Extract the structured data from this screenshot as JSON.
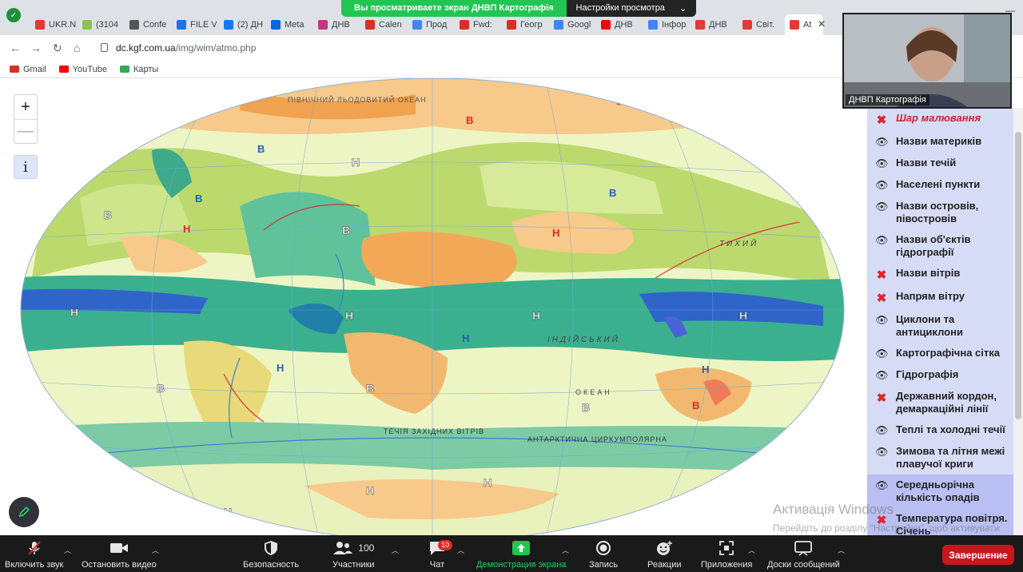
{
  "tabs": [
    {
      "label": "UKR.N",
      "color": "#e53935"
    },
    {
      "label": "(3104",
      "color": "#8bc34a"
    },
    {
      "label": "Confe",
      "color": "#555555"
    },
    {
      "label": "FILE V",
      "color": "#1a73e8"
    },
    {
      "label": "(2) ДН",
      "color": "#1877f2"
    },
    {
      "label": "Meta",
      "color": "#0668e1"
    },
    {
      "label": "ДНВ",
      "color": "#c13584"
    },
    {
      "label": "Calen",
      "color": "#d93025"
    },
    {
      "label": "Прод",
      "color": "#4285f4"
    },
    {
      "label": "Fwd:",
      "color": "#d93025"
    },
    {
      "label": "Геогр",
      "color": "#d93025"
    },
    {
      "label": "Googl",
      "color": "#4285f4"
    },
    {
      "label": "ДНВ",
      "color": "#ff0000"
    },
    {
      "label": "Інфор",
      "color": "#4285f4"
    },
    {
      "label": "ДНВ",
      "color": "#e53935"
    },
    {
      "label": "Світ.",
      "color": "#e53935"
    },
    {
      "label": "At",
      "color": "#e53935"
    }
  ],
  "share_banner": {
    "message": "Вы просматриваете экран ДНВП Картографія",
    "settings": "Настройки просмотра",
    "caret": "⌄"
  },
  "address": {
    "host": "dc.kgf.com.ua",
    "path": "/img/wim/atmo.php"
  },
  "bookmarks": [
    {
      "label": "Gmail",
      "color": "#d93025"
    },
    {
      "label": "YouTube",
      "color": "#ff0000"
    },
    {
      "label": "Карты",
      "color": "#34a853"
    }
  ],
  "map_controls": {
    "zoom_in": "+",
    "zoom_out": "—",
    "info": "i"
  },
  "map_labels": {
    "ocean_arctic": "ПІВНІЧНИЙ    ЛЬОДОВИТИЙ    ОКЕАН",
    "ocean_pacific": "ТИХИЙ",
    "ocean_indian": "ІНДІЙСЬКИЙ",
    "ocean_label": "ОКЕАН",
    "southern_current": "ТЕЧІЯ  ЗАХІДНИХ  ВІТРІВ",
    "antarctic_current": "АНТАРКТИЧНА  ЦИРКУМПОЛЯРНА",
    "high_pressure": "В",
    "low_pressure": "Н",
    "red_low": "Н"
  },
  "layers": [
    {
      "label": "Шар малювання",
      "state": "off",
      "style": "italic"
    },
    {
      "label": "Назви материків",
      "state": "on"
    },
    {
      "label": "Назви течій",
      "state": "on"
    },
    {
      "label": "Населені пункти",
      "state": "on"
    },
    {
      "label": "Назви островів, півостровів",
      "state": "on"
    },
    {
      "label": "Назви об'єктів гідрографії",
      "state": "on"
    },
    {
      "label": "Назви вітрів",
      "state": "off"
    },
    {
      "label": "Напрям вітру",
      "state": "off"
    },
    {
      "label": "Циклони та антициклони",
      "state": "on"
    },
    {
      "label": "Картографічна сітка",
      "state": "on"
    },
    {
      "label": "Гідрографія",
      "state": "on"
    },
    {
      "label": "Державний кордон, демаркаційні лінії",
      "state": "off"
    },
    {
      "label": "Теплі та холодні течії",
      "state": "on"
    },
    {
      "label": "Зимова та літня межі плавучої криги",
      "state": "on"
    },
    {
      "label": "Середньорічна кількість опадів",
      "state": "on",
      "highlight": true
    },
    {
      "label": "Температура повітря. Січень",
      "state": "off",
      "highlight": true
    }
  ],
  "video": {
    "name": "ДНВП Картографія"
  },
  "watermark": {
    "title": "Активація Windows",
    "subtitle": "Перейдіть до розділу \"Настройки\", щоб активувати Windows."
  },
  "toolbar": {
    "unmute": "Включить звук",
    "start_video": "Остановить видео",
    "security": "Безопасность",
    "participants": "Участники",
    "participants_count": "100",
    "chat": "Чат",
    "chat_badge": "10",
    "share": "Демонстрация экрана",
    "record": "Запись",
    "reactions": "Реакции",
    "apps": "Приложения",
    "whiteboard": "Доски сообщений",
    "end": "Завершение"
  },
  "colors": {
    "layer_panel": "#d7dcf6",
    "layer_highlight": "#b9bff2",
    "share_green": "#23c552",
    "end_red": "#c8161d"
  }
}
